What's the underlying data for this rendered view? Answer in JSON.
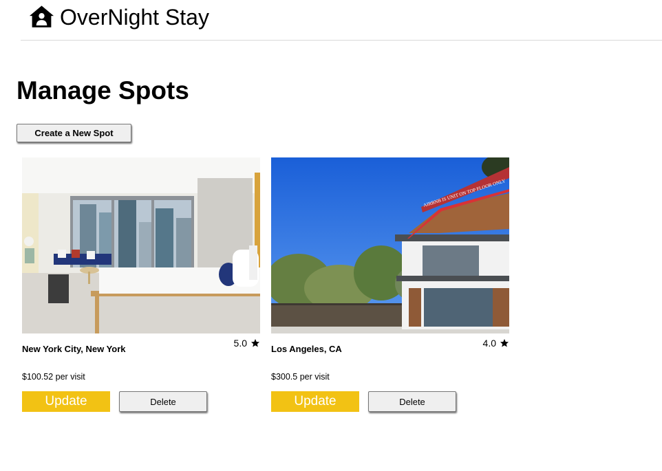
{
  "header": {
    "brand_name": "OverNight Stay",
    "logo_icon": "house-user-icon"
  },
  "page": {
    "title": "Manage Spots"
  },
  "actions": {
    "create_label": "Create a New Spot"
  },
  "spots": [
    {
      "location": "New York City, New York",
      "rating": "5.0",
      "price": "$100.52 per visit",
      "update_label": "Update",
      "delete_label": "Delete",
      "image": "hotel-bedroom-photo"
    },
    {
      "location": "Los Angeles, CA",
      "rating": "4.0",
      "price": "$300.5 per visit",
      "update_label": "Update",
      "delete_label": "Delete",
      "image": "house-exterior-photo",
      "image_overlay_text": "AIRBNB IS UNIT ON TOP FLOOR ONLY"
    }
  ],
  "colors": {
    "accent": "#f2c214",
    "button_bg": "#efefef",
    "divider": "#d9d9d9"
  }
}
